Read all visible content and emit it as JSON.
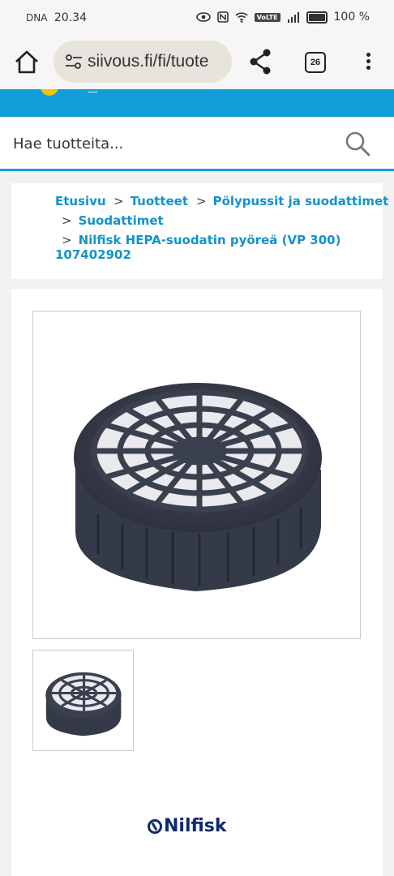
{
  "status_bar": {
    "carrier": "DNA",
    "time": "20.34",
    "network": "VoLTE",
    "battery": "100 %"
  },
  "browser": {
    "url": "siivous.fi/fi/tuote",
    "tab_count": "26"
  },
  "search": {
    "placeholder": "Hae tuotteita..."
  },
  "breadcrumb": {
    "separator": ">",
    "items": [
      "Etusivu",
      "Tuotteet",
      "Pölypussit ja suodattimet",
      "Suodattimet",
      "Nilfisk HEPA-suodatin pyöreä (VP 300)",
      "107402902"
    ]
  },
  "product": {
    "brand_logo": "Nilfisk"
  },
  "colors": {
    "accent": "#149ed9",
    "link": "#1493c8",
    "brand": "#0e2a6e"
  }
}
